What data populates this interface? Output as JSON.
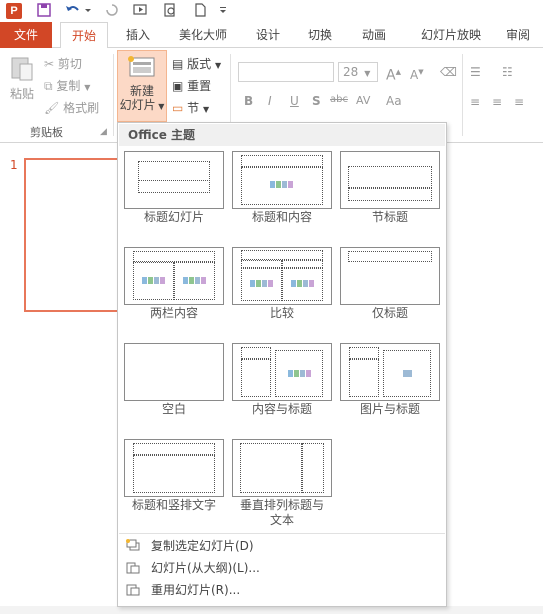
{
  "qat": {
    "app_icon": "P",
    "icons": [
      "save-icon",
      "undo-icon",
      "redo-icon",
      "present-from-beginning-icon",
      "print-preview-icon",
      "new-document-icon",
      "customize-qat-icon"
    ]
  },
  "tabs": [
    "文件",
    "开始",
    "插入",
    "美化大师",
    "设计",
    "切换",
    "动画",
    "幻灯片放映",
    "审阅"
  ],
  "clipboard": {
    "paste": "粘贴",
    "cut": "剪切",
    "copy": "复制",
    "format_painter": "格式刷",
    "group_label": "剪贴板"
  },
  "slides": {
    "new_slide_line1": "新建",
    "new_slide_line2": "幻灯片",
    "layout": "版式",
    "reset": "重置",
    "section": "节"
  },
  "font": {
    "size": "28",
    "grow": "A",
    "shrink": "A",
    "bold": "B",
    "italic": "I",
    "underline": "U",
    "shadow": "S",
    "strike": "abc",
    "spacing": "AV",
    "case": "Aa"
  },
  "slide_panel": {
    "number": "1"
  },
  "gallery": {
    "header": "Office 主题",
    "layouts": [
      "标题幻灯片",
      "标题和内容",
      "节标题",
      "两栏内容",
      "比较",
      "仅标题",
      "空白",
      "内容与标题",
      "图片与标题",
      "标题和竖排文字",
      "垂直排列标题与文本"
    ],
    "menu": [
      "复制选定幻灯片(D)",
      "幻灯片(从大纲)(L)...",
      "重用幻灯片(R)..."
    ]
  },
  "colors": {
    "accent": "#d24726",
    "highlight": "#fcd9c6"
  }
}
